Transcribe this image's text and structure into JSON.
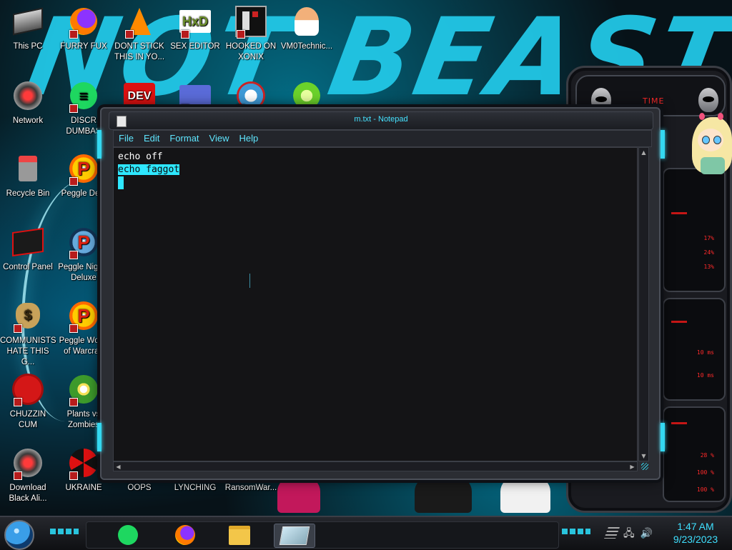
{
  "wallpaper": {
    "title_text": "NOT BEAST"
  },
  "desktop": {
    "icons": [
      {
        "label": "This PC",
        "icon": "computer-icon"
      },
      {
        "label": "FURRY FUX",
        "icon": "firefox-icon"
      },
      {
        "label": "DONT STICK THIS IN YO...",
        "icon": "vlc-cone-icon"
      },
      {
        "label": "SEX EDITOR",
        "icon": "hxd-icon"
      },
      {
        "label": "HOOKED ON XONIX",
        "icon": "xonix-icon"
      },
      {
        "label": "VM0Technic...",
        "icon": "doctor-icon"
      },
      {
        "label": "Network",
        "icon": "alienware-icon"
      },
      {
        "label": "DISCR DUMBAS",
        "icon": "green-document-icon"
      },
      {
        "label": "DEV",
        "icon": "dev-cpp-icon"
      },
      {
        "label": "",
        "icon": "card-icon"
      },
      {
        "label": "",
        "icon": "christmas-game-icon"
      },
      {
        "label": "",
        "icon": "limewire-icon"
      },
      {
        "label": "Recycle Bin",
        "icon": "recycle-bin-icon"
      },
      {
        "label": "Peggle Delu",
        "icon": "peggle-icon"
      },
      {
        "label": "Control Panel",
        "icon": "control-panel-icon"
      },
      {
        "label": "Peggle Nights Deluxe",
        "icon": "peggle-nights-icon"
      },
      {
        "label": "COMMUNISTS HATE THIS G...",
        "icon": "money-bag-icon"
      },
      {
        "label": "Peggle World of Warcraft",
        "icon": "peggle-wow-icon"
      },
      {
        "label": "CHUZZIN CUM",
        "icon": "chuzzle-icon"
      },
      {
        "label": "Plants vs Zombies",
        "icon": "pvz-icon"
      },
      {
        "label": "Download Black Ali...",
        "icon": "alienware-download-icon"
      },
      {
        "label": "UKRAINE",
        "icon": "nuclear-icon"
      },
      {
        "label": "OOPS",
        "icon": "none"
      },
      {
        "label": "LYNCHING",
        "icon": "none"
      },
      {
        "label": "RansomWar...",
        "icon": "none"
      }
    ]
  },
  "gadget": {
    "time_label": "TIME",
    "readouts": [
      "17%",
      "24%",
      "13%",
      "10 ms",
      "10 ms",
      "28 %",
      "100 %",
      "100 %"
    ]
  },
  "notepad": {
    "title": "m.txt - Notepad",
    "menu": [
      "File",
      "Edit",
      "Format",
      "View",
      "Help"
    ],
    "lines": [
      "echo off",
      "echo faggot"
    ],
    "scroll_up": "▲",
    "scroll_down": "▼",
    "scroll_left": "◀",
    "scroll_right": "▶"
  },
  "taskbar": {
    "buttons": [
      {
        "name": "taskbar-green-app",
        "icon": "green-document-icon"
      },
      {
        "name": "taskbar-firefox",
        "icon": "firefox-icon"
      },
      {
        "name": "taskbar-file-explorer",
        "icon": "folder-icon"
      },
      {
        "name": "taskbar-notepad",
        "icon": "notepad-icon",
        "active": true
      }
    ],
    "tray": {
      "network": "🖧",
      "volume": "🔊"
    },
    "clock": {
      "time": "1:47 AM",
      "date": "9/23/2023"
    }
  },
  "colors": {
    "accent": "#2ee7ff",
    "window_bg": "#141416",
    "gadget_red": "#ff2a2a"
  }
}
